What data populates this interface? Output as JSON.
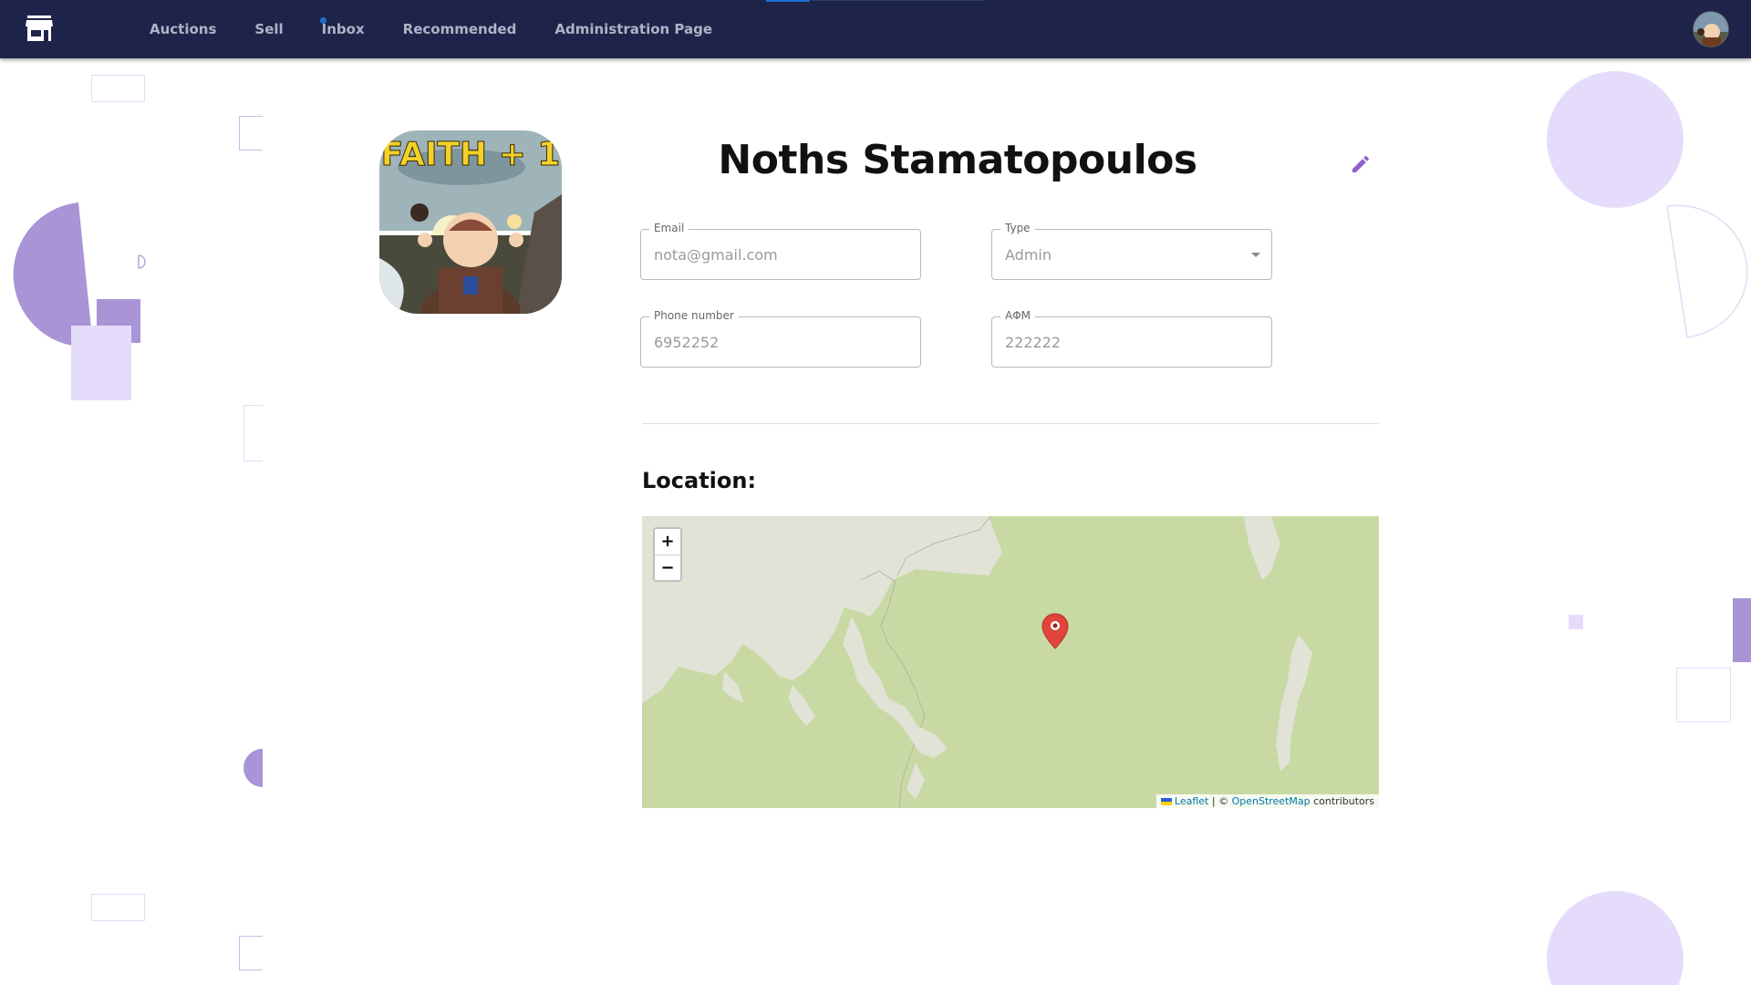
{
  "nav": {
    "items": [
      {
        "label": "Auctions"
      },
      {
        "label": "Sell"
      },
      {
        "label": "Inbox"
      },
      {
        "label": "Recommended"
      },
      {
        "label": "Administration Page"
      }
    ],
    "logo_icon": "storefront-icon",
    "avatar_icon": "user-avatar"
  },
  "profile": {
    "name": "Noths Stamatopoulos",
    "image_caption": "FAITH + 1",
    "edit_icon": "pencil-icon",
    "fields": {
      "email": {
        "label": "Email",
        "value": "nota@gmail.com"
      },
      "type": {
        "label": "Type",
        "value": "Admin"
      },
      "phone": {
        "label": "Phone number",
        "value": "6952252"
      },
      "afm": {
        "label": "ΑΦΜ",
        "value": "222222"
      }
    }
  },
  "location": {
    "title": "Location:",
    "map": {
      "zoom_in": "+",
      "zoom_out": "−",
      "attribution": {
        "leaflet": "Leaflet",
        "separator": " | © ",
        "osm": "OpenStreetMap",
        "suffix": " contributors"
      }
    }
  },
  "colors": {
    "topbar": "#1e2449",
    "accent": "#8e5fd0",
    "land": "#c8d9a3",
    "urban": "#e0e3d6",
    "marker": "#e0443a"
  }
}
